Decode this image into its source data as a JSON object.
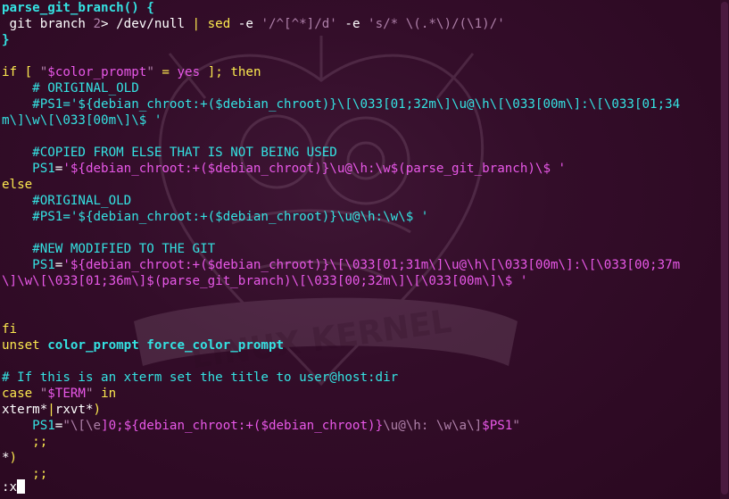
{
  "editor": {
    "command_line": ":x",
    "watermark_text": "LINUX KERNEL"
  },
  "lines": [
    {
      "segments": [
        {
          "t": "parse_git_branch() {",
          "c": "cyan",
          "b": true
        }
      ]
    },
    {
      "segments": [
        {
          "t": " git branch ",
          "c": "white"
        },
        {
          "t": "2",
          "c": "pink"
        },
        {
          "t": "> /dev/null ",
          "c": "white"
        },
        {
          "t": "|",
          "c": "yellow"
        },
        {
          "t": " ",
          "c": "white"
        },
        {
          "t": "sed",
          "c": "yellow"
        },
        {
          "t": " -e ",
          "c": "white"
        },
        {
          "t": "'/^[^*]/d'",
          "c": "pink"
        },
        {
          "t": " -e ",
          "c": "white"
        },
        {
          "t": "'s/* \\(.*\\)/(\\1)/'",
          "c": "pink"
        }
      ]
    },
    {
      "segments": [
        {
          "t": "}",
          "c": "cyan",
          "b": true
        }
      ]
    },
    {
      "segments": [
        {
          "t": "",
          "c": "white"
        }
      ]
    },
    {
      "segments": [
        {
          "t": "if",
          "c": "yellow"
        },
        {
          "t": " ",
          "c": "white"
        },
        {
          "t": "[",
          "c": "yellow"
        },
        {
          "t": " ",
          "c": "white"
        },
        {
          "t": "\"",
          "c": "pink"
        },
        {
          "t": "$color_prompt",
          "c": "magenta"
        },
        {
          "t": "\"",
          "c": "pink"
        },
        {
          "t": " ",
          "c": "white"
        },
        {
          "t": "=",
          "c": "yellow"
        },
        {
          "t": " ",
          "c": "white"
        },
        {
          "t": "yes",
          "c": "magenta"
        },
        {
          "t": " ",
          "c": "white"
        },
        {
          "t": "];",
          "c": "yellow"
        },
        {
          "t": " ",
          "c": "white"
        },
        {
          "t": "then",
          "c": "yellow"
        }
      ]
    },
    {
      "segments": [
        {
          "t": "    # ORIGINAL_OLD",
          "c": "cyan"
        }
      ]
    },
    {
      "segments": [
        {
          "t": "    #PS1='${debian_chroot:+($debian_chroot)}\\[\\033[01;32m\\]\\u@\\h\\[\\033[00m\\]:\\[\\033[01;34",
          "c": "cyan"
        }
      ]
    },
    {
      "segments": [
        {
          "t": "m\\]\\w\\[\\033[00m\\]\\$ '",
          "c": "cyan"
        }
      ]
    },
    {
      "segments": [
        {
          "t": "",
          "c": "white"
        }
      ]
    },
    {
      "segments": [
        {
          "t": "    #COPIED FROM ELSE THAT IS NOT BEING USED",
          "c": "cyan"
        }
      ]
    },
    {
      "segments": [
        {
          "t": "    ",
          "c": "white"
        },
        {
          "t": "PS1",
          "c": "cyan"
        },
        {
          "t": "=",
          "c": "white"
        },
        {
          "t": "'${debian_chroot:+($debian_chroot)}\\u@\\h:\\w$(parse_git_branch)\\$ '",
          "c": "magenta"
        }
      ]
    },
    {
      "segments": [
        {
          "t": "else",
          "c": "yellow"
        }
      ]
    },
    {
      "segments": [
        {
          "t": "    #ORIGINAL_OLD",
          "c": "cyan"
        }
      ]
    },
    {
      "segments": [
        {
          "t": "    #PS1='${debian_chroot:+($debian_chroot)}\\u@\\h:\\w\\$ '",
          "c": "cyan"
        }
      ]
    },
    {
      "segments": [
        {
          "t": "",
          "c": "white"
        }
      ]
    },
    {
      "segments": [
        {
          "t": "    #NEW MODIFIED TO THE GIT",
          "c": "cyan"
        }
      ]
    },
    {
      "segments": [
        {
          "t": "    ",
          "c": "white"
        },
        {
          "t": "PS1",
          "c": "cyan"
        },
        {
          "t": "=",
          "c": "white"
        },
        {
          "t": "'${debian_chroot:+($debian_chroot)}\\[\\033[01;31m\\]\\u@\\h\\[\\033[00m\\]:\\[\\033[00;37m",
          "c": "magenta"
        }
      ]
    },
    {
      "segments": [
        {
          "t": "\\]\\w\\[\\033[01;36m\\]$(parse_git_branch)\\[\\033[00;32m\\]\\[\\033[00m\\]\\$ '",
          "c": "magenta"
        }
      ]
    },
    {
      "segments": [
        {
          "t": "",
          "c": "white"
        }
      ]
    },
    {
      "segments": [
        {
          "t": "",
          "c": "white"
        }
      ]
    },
    {
      "segments": [
        {
          "t": "fi",
          "c": "yellow"
        }
      ]
    },
    {
      "segments": [
        {
          "t": "unset",
          "c": "yellow"
        },
        {
          "t": " ",
          "c": "white"
        },
        {
          "t": "color_prompt force_color_prompt",
          "c": "cyan",
          "b": true
        }
      ]
    },
    {
      "segments": [
        {
          "t": "",
          "c": "white"
        }
      ]
    },
    {
      "segments": [
        {
          "t": "# If this is an xterm set the title to user@host:dir",
          "c": "cyan"
        }
      ]
    },
    {
      "segments": [
        {
          "t": "case",
          "c": "yellow"
        },
        {
          "t": " ",
          "c": "white"
        },
        {
          "t": "\"",
          "c": "pink"
        },
        {
          "t": "$TERM",
          "c": "magenta"
        },
        {
          "t": "\"",
          "c": "pink"
        },
        {
          "t": " ",
          "c": "white"
        },
        {
          "t": "in",
          "c": "yellow"
        }
      ]
    },
    {
      "segments": [
        {
          "t": "xterm*",
          "c": "white"
        },
        {
          "t": "|",
          "c": "yellow"
        },
        {
          "t": "rxvt*",
          "c": "white"
        },
        {
          "t": ")",
          "c": "yellow"
        }
      ]
    },
    {
      "segments": [
        {
          "t": "    ",
          "c": "white"
        },
        {
          "t": "PS1",
          "c": "cyan"
        },
        {
          "t": "=",
          "c": "white"
        },
        {
          "t": "\"",
          "c": "pink"
        },
        {
          "t": "\\[\\e",
          "c": "pink"
        },
        {
          "t": "]0;",
          "c": "magenta"
        },
        {
          "t": "${debian_chroot:+(",
          "c": "magenta"
        },
        {
          "t": "$debian_chroot",
          "c": "magenta"
        },
        {
          "t": ")}",
          "c": "magenta"
        },
        {
          "t": "\\u@\\h: \\w\\a\\]",
          "c": "pink"
        },
        {
          "t": "$PS1",
          "c": "magenta"
        },
        {
          "t": "\"",
          "c": "pink"
        }
      ]
    },
    {
      "segments": [
        {
          "t": "    ",
          "c": "white"
        },
        {
          "t": ";;",
          "c": "yellow"
        }
      ]
    },
    {
      "segments": [
        {
          "t": "*",
          "c": "white"
        },
        {
          "t": ")",
          "c": "yellow"
        }
      ]
    },
    {
      "segments": [
        {
          "t": "    ",
          "c": "white"
        },
        {
          "t": ";;",
          "c": "yellow"
        }
      ]
    }
  ]
}
